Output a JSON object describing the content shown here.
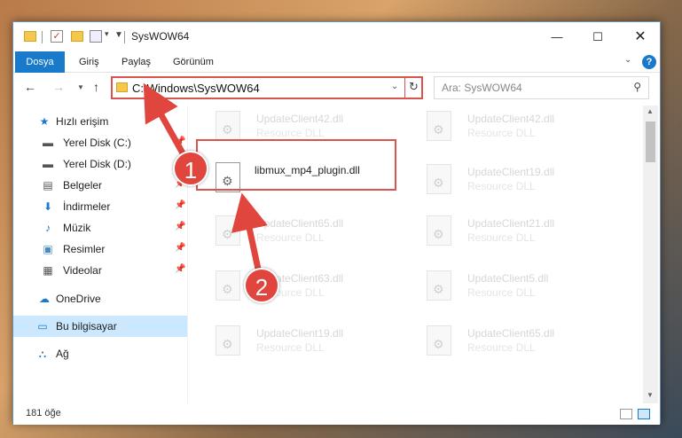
{
  "window": {
    "title": "SysWOW64",
    "min_glyph": "—",
    "max_glyph": "☐",
    "close_glyph": "✕"
  },
  "ribbon": {
    "tabs": [
      "Dosya",
      "Giriş",
      "Paylaş",
      "Görünüm"
    ]
  },
  "address": {
    "path": "C:\\Windows\\SysWOW64",
    "search_placeholder": "Ara: SysWOW64"
  },
  "sidebar": {
    "items": [
      {
        "label": "Hızlı erişim",
        "icon": "star-icon",
        "pinned": false
      },
      {
        "label": "Yerel Disk (C:)",
        "icon": "drive-icon",
        "pinned": true
      },
      {
        "label": "Yerel Disk (D:)",
        "icon": "drive-icon",
        "pinned": true
      },
      {
        "label": "Belgeler",
        "icon": "documents-icon",
        "pinned": true
      },
      {
        "label": "İndirmeler",
        "icon": "download-icon",
        "pinned": true
      },
      {
        "label": "Müzik",
        "icon": "music-icon",
        "pinned": true
      },
      {
        "label": "Resimler",
        "icon": "pictures-icon",
        "pinned": true
      },
      {
        "label": "Videolar",
        "icon": "videos-icon",
        "pinned": true
      },
      {
        "label": "OneDrive",
        "icon": "cloud-icon",
        "pinned": false
      },
      {
        "label": "Bu bilgisayar",
        "icon": "computer-icon",
        "pinned": false,
        "selected": true
      },
      {
        "label": "Ağ",
        "icon": "network-icon",
        "pinned": false
      }
    ]
  },
  "files": {
    "left": [
      {
        "name": "UpdateClient42.dll",
        "type": "Resource DLL"
      },
      {
        "name": "libmux_mp4_plugin.dll",
        "type": "",
        "highlighted": true
      },
      {
        "name": "UpdateClient65.dll",
        "type": "Resource DLL"
      },
      {
        "name": "UpdateClient63.dll",
        "type": "Resource DLL"
      },
      {
        "name": "UpdateClient19.dll",
        "type": "Resource DLL"
      }
    ],
    "right": [
      {
        "name": "UpdateClient42.dll",
        "type": "Resource DLL"
      },
      {
        "name": "UpdateClient19.dll",
        "type": "Resource DLL"
      },
      {
        "name": "UpdateClient21.dll",
        "type": "Resource DLL"
      },
      {
        "name": "UpdateClient5.dll",
        "type": "Resource DLL"
      },
      {
        "name": "UpdateClient65.dll",
        "type": "Resource DLL"
      }
    ]
  },
  "status": {
    "count": "181 öğe"
  },
  "annotations": {
    "step1": "1",
    "step2": "2",
    "color": "#e0453e"
  }
}
